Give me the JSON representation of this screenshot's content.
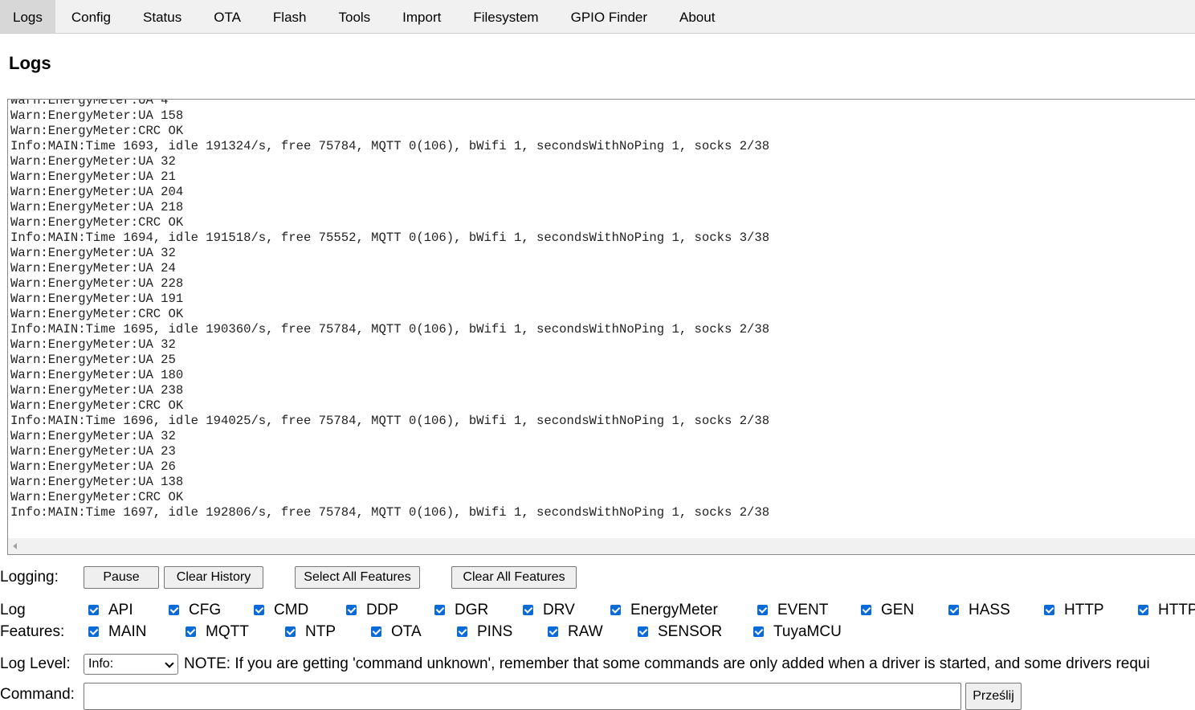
{
  "tabs": [
    {
      "label": "Logs",
      "active": true
    },
    {
      "label": "Config"
    },
    {
      "label": "Status"
    },
    {
      "label": "OTA"
    },
    {
      "label": "Flash"
    },
    {
      "label": "Tools"
    },
    {
      "label": "Import"
    },
    {
      "label": "Filesystem"
    },
    {
      "label": "GPIO Finder"
    },
    {
      "label": "About"
    }
  ],
  "page_title": "Logs",
  "log_lines": [
    "Warn:EnergyMeter:UA 4",
    "Warn:EnergyMeter:UA 158",
    "Warn:EnergyMeter:CRC OK",
    "Info:MAIN:Time 1693, idle 191324/s, free 75784, MQTT 0(106), bWifi 1, secondsWithNoPing 1, socks 2/38",
    "Warn:EnergyMeter:UA 32",
    "Warn:EnergyMeter:UA 21",
    "Warn:EnergyMeter:UA 204",
    "Warn:EnergyMeter:UA 218",
    "Warn:EnergyMeter:CRC OK",
    "Info:MAIN:Time 1694, idle 191518/s, free 75552, MQTT 0(106), bWifi 1, secondsWithNoPing 1, socks 3/38",
    "Warn:EnergyMeter:UA 32",
    "Warn:EnergyMeter:UA 24",
    "Warn:EnergyMeter:UA 228",
    "Warn:EnergyMeter:UA 191",
    "Warn:EnergyMeter:CRC OK",
    "Info:MAIN:Time 1695, idle 190360/s, free 75784, MQTT 0(106), bWifi 1, secondsWithNoPing 1, socks 2/38",
    "Warn:EnergyMeter:UA 32",
    "Warn:EnergyMeter:UA 25",
    "Warn:EnergyMeter:UA 180",
    "Warn:EnergyMeter:UA 238",
    "Warn:EnergyMeter:CRC OK",
    "Info:MAIN:Time 1696, idle 194025/s, free 75784, MQTT 0(106), bWifi 1, secondsWithNoPing 1, socks 2/38",
    "Warn:EnergyMeter:UA 32",
    "Warn:EnergyMeter:UA 23",
    "Warn:EnergyMeter:UA 26",
    "Warn:EnergyMeter:UA 138",
    "Warn:EnergyMeter:CRC OK",
    "Info:MAIN:Time 1697, idle 192806/s, free 75784, MQTT 0(106), bWifi 1, secondsWithNoPing 1, socks 2/38"
  ],
  "logging": {
    "label": "Logging:",
    "pause": "Pause",
    "clear_history": "Clear History",
    "select_all": "Select All Features",
    "clear_all": "Clear All Features"
  },
  "features": {
    "label_line1": "Log",
    "label_line2": "Features:",
    "row1": [
      "API",
      "CFG",
      "CMD",
      "DDP",
      "DGR",
      "DRV",
      "EnergyMeter",
      "EVENT",
      "GEN",
      "HASS",
      "HTTP",
      "HTTP"
    ],
    "row2": [
      "MAIN",
      "MQTT",
      "NTP",
      "OTA",
      "PINS",
      "RAW",
      "SENSOR",
      "TuyaMCU"
    ]
  },
  "log_level": {
    "label": "Log Level:",
    "selected": "Info:",
    "note": "NOTE: If you are getting 'command unknown', remember that some commands are only added when a driver is started, and some drivers requi"
  },
  "command": {
    "label": "Command:",
    "value": "",
    "send": "Prześlij"
  },
  "colors": {
    "checkbox": "#0a6bd6",
    "tabbar_bg": "#f1f1f1",
    "tab_active_bg": "#d7d7d7"
  }
}
